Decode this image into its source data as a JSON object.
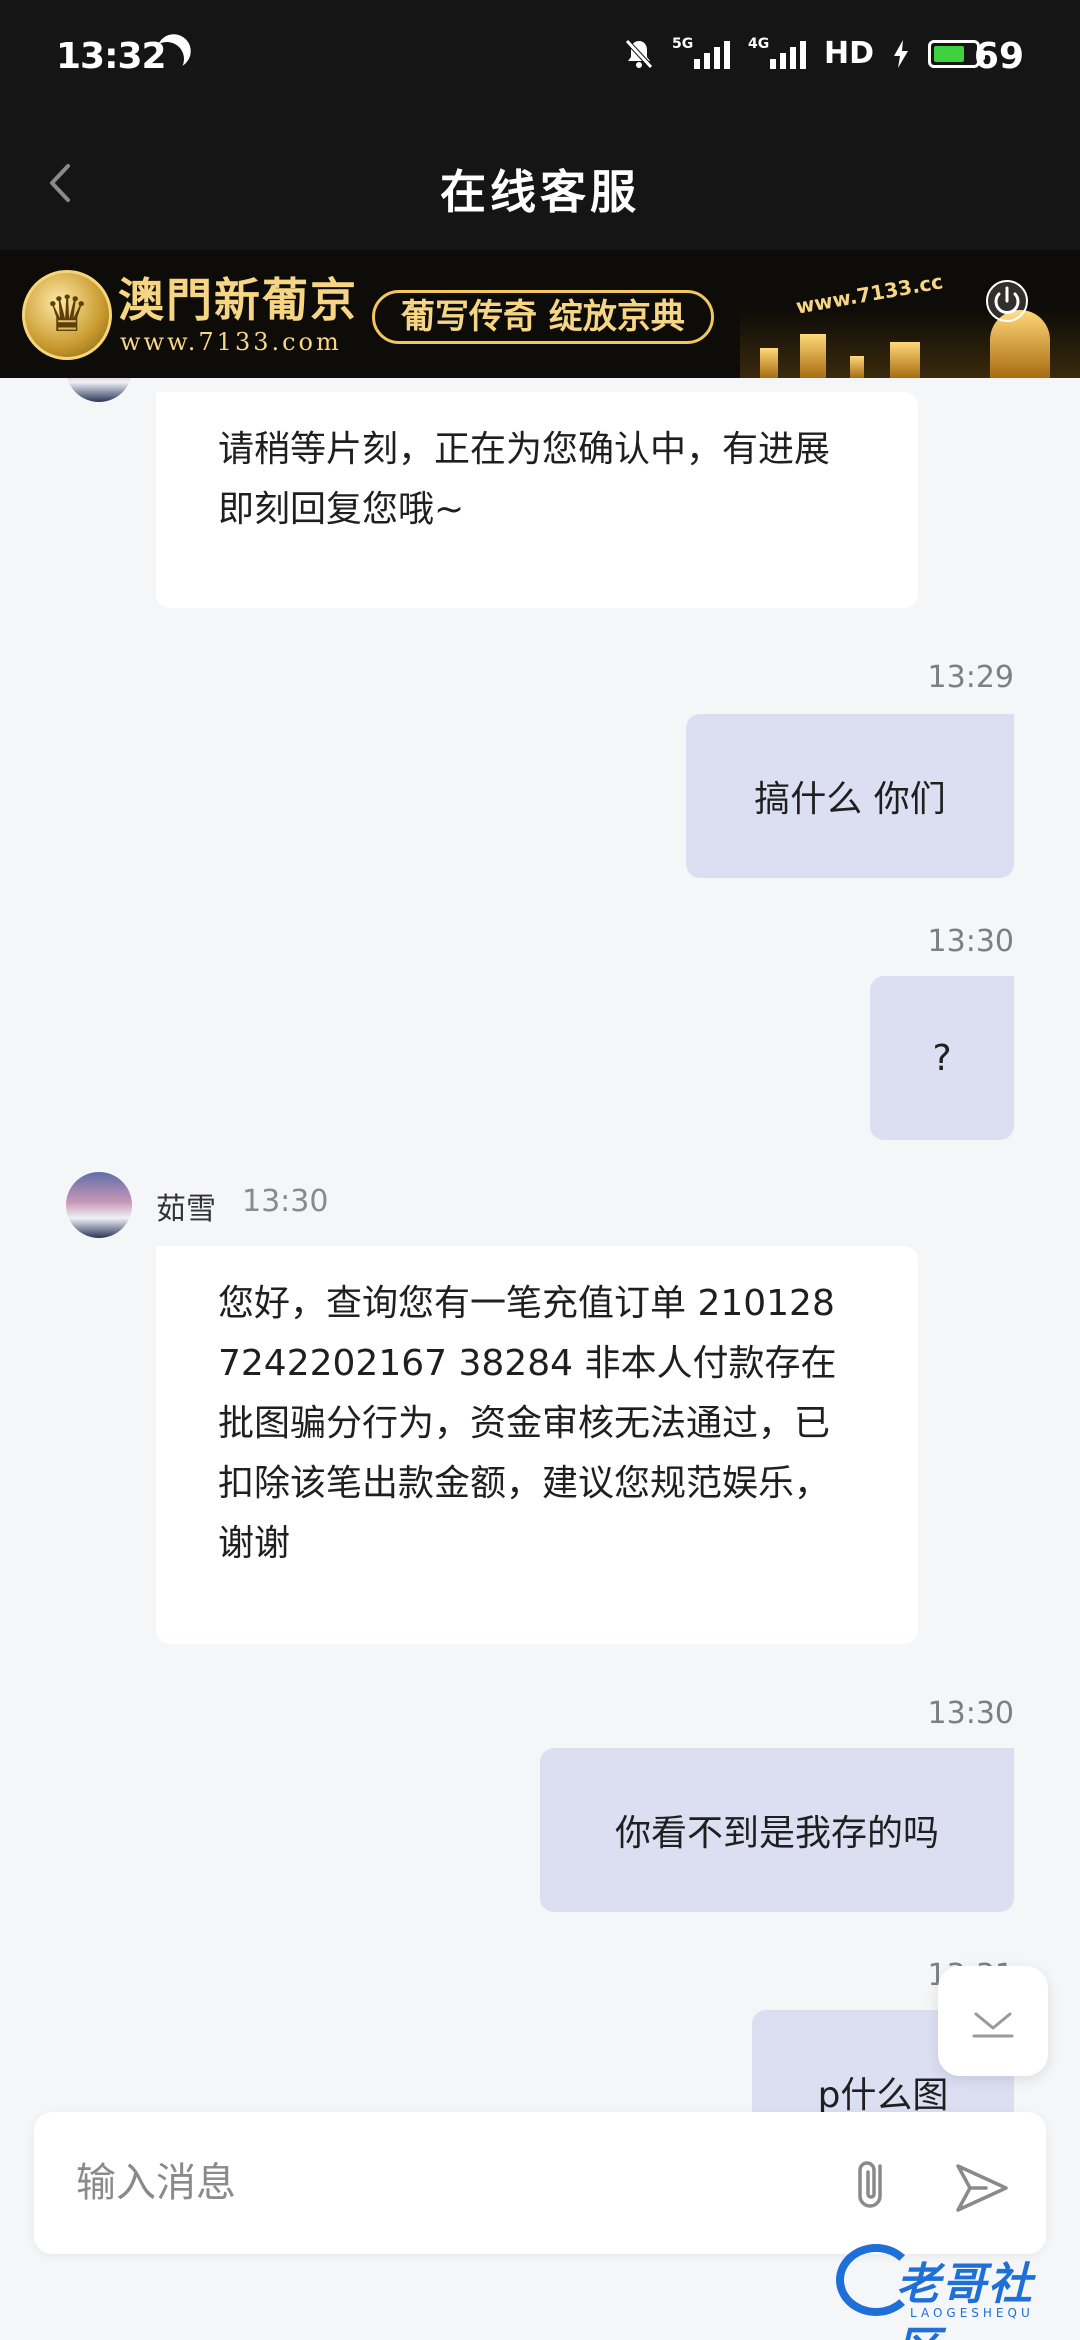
{
  "status_bar": {
    "time": "13:32",
    "network_5g": "5G",
    "network_4g": "4G",
    "hd": "HD",
    "battery": "69"
  },
  "header": {
    "title": "在线客服"
  },
  "banner": {
    "brand": "澳門新葡京",
    "url": "www.7133.com",
    "slogan": "葡写传奇 绽放京典",
    "site": "www.7133.cc"
  },
  "messages": [
    {
      "from": "agent",
      "text": "请稍等片刻，正在为您确认中，有进展即刻回复您哦~"
    },
    {
      "from": "me",
      "time": "13:29",
      "text": "搞什么 你们"
    },
    {
      "from": "me",
      "time": "13:30",
      "text": "?"
    },
    {
      "from": "agent",
      "name": "茹雪",
      "time": "13:30",
      "text": "您好，查询您有一笔充值订单 2101287242202167 38284 非本人付款存在批图骗分行为，资金审核无法通过，已扣除该笔出款金额，建议您规范娱乐，谢谢"
    },
    {
      "from": "me",
      "time": "13:30",
      "text": "你看不到是我存的吗"
    },
    {
      "from": "me",
      "time": "13:31",
      "text": "p什么图"
    }
  ],
  "input": {
    "placeholder": "输入消息"
  },
  "watermark": {
    "text": "老哥社区",
    "sub": "LAOGESHEQU"
  },
  "colors": {
    "my_bubble": "#dcdff2",
    "agent_bubble": "#ffffff",
    "background": "#f5f6f8",
    "header": "#151515"
  }
}
